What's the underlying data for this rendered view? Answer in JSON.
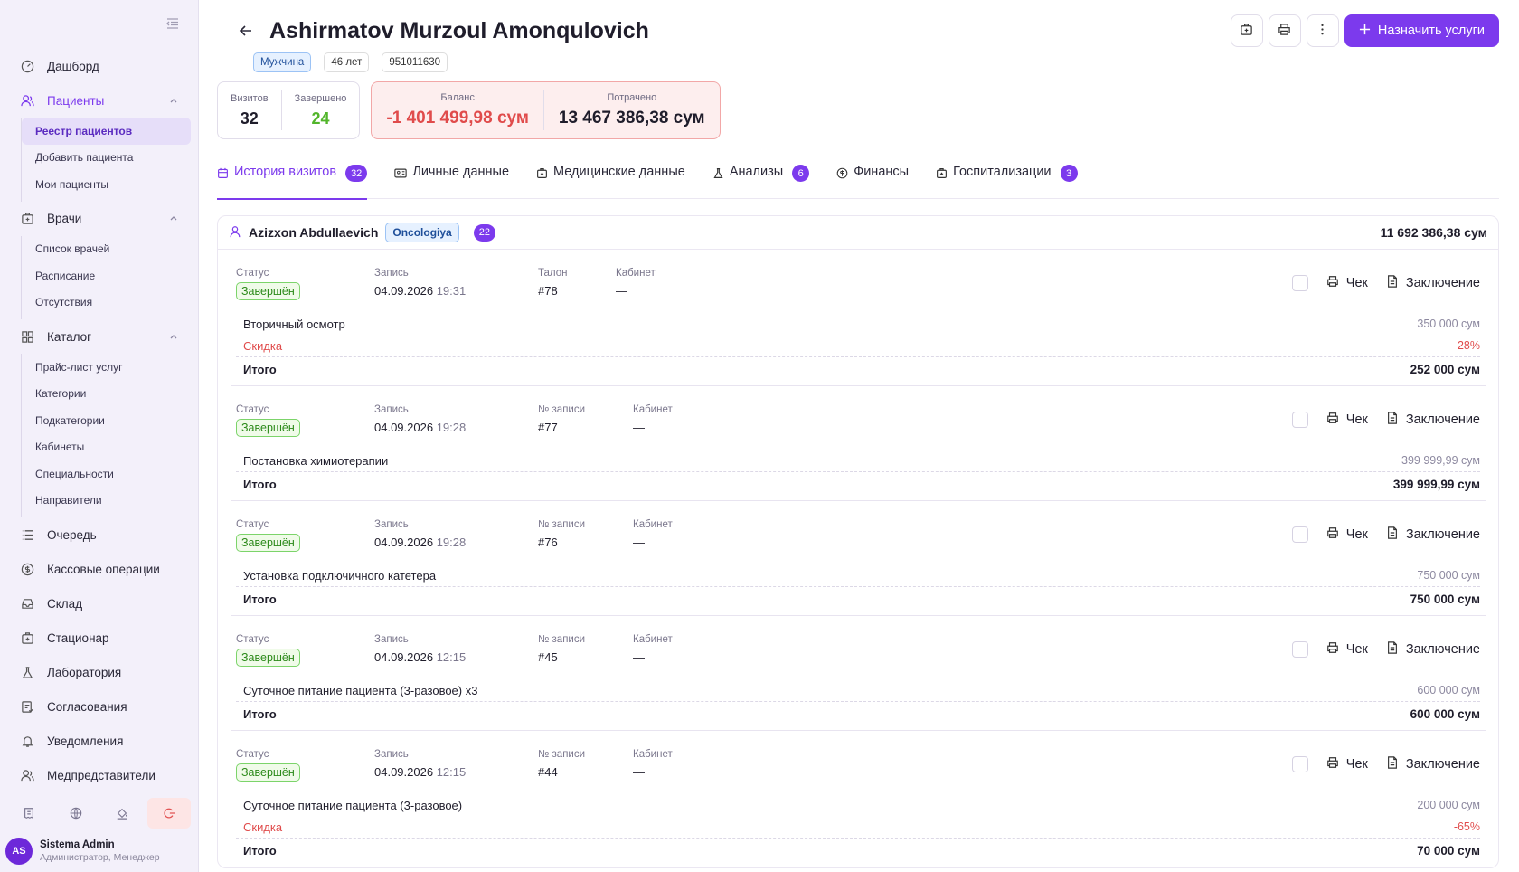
{
  "sidebar": {
    "nav": [
      {
        "label": "Дашборд",
        "icon": "gauge-icon"
      },
      {
        "label": "Пациенты",
        "icon": "users-icon"
      },
      {
        "label": "Врачи",
        "icon": "hospital-bag-icon"
      },
      {
        "label": "Каталог",
        "icon": "grid-icon"
      },
      {
        "label": "Очередь",
        "icon": "list-icon"
      },
      {
        "label": "Кассовые операции",
        "icon": "dollar-icon"
      },
      {
        "label": "Склад",
        "icon": "inbox-icon"
      },
      {
        "label": "Стационар",
        "icon": "hospital-icon"
      },
      {
        "label": "Лаборатория",
        "icon": "flask-icon"
      },
      {
        "label": "Согласования",
        "icon": "approve-icon"
      },
      {
        "label": "Уведомления",
        "icon": "bell-icon"
      },
      {
        "label": "Медпредставители",
        "icon": "users-icon"
      }
    ],
    "patients_sub": [
      "Реестр пациентов",
      "Добавить пациента",
      "Мои пациенты"
    ],
    "doctors_sub": [
      "Список врачей",
      "Расписание",
      "Отсутствия"
    ],
    "catalog_sub": [
      "Прайс-лист услуг",
      "Категории",
      "Подкатегории",
      "Кабинеты",
      "Специальности",
      "Направители"
    ],
    "user": {
      "initials": "AS",
      "name": "Sistema Admin",
      "role": "Администратор, Менеджер"
    }
  },
  "header": {
    "title": "Ashirmatov Murzoul Amonqulovich",
    "assign_label": "Назначить услуги",
    "tags": [
      "Мужчина",
      "46 лет",
      "951011630"
    ]
  },
  "stats": {
    "visits_label": "Визитов",
    "visits": "32",
    "done_label": "Завершено",
    "done": "24",
    "balance_label": "Баланс",
    "balance": "-1 401 499,98 сум",
    "spent_label": "Потрачено",
    "spent": "13 467 386,38 сум"
  },
  "tabs": [
    {
      "label": "История визитов",
      "badge": "32"
    },
    {
      "label": "Личные данные",
      "badge": ""
    },
    {
      "label": "Медицинские данные",
      "badge": ""
    },
    {
      "label": "Анализы",
      "badge": "6"
    },
    {
      "label": "Финансы",
      "badge": ""
    },
    {
      "label": "Госпитализации",
      "badge": "3"
    }
  ],
  "doctor_card": {
    "name": "Azizxon Abdullaevich",
    "specialty": "Oncologiya",
    "count": "22",
    "total": "11 692 386,38 сум"
  },
  "labels": {
    "status": "Статус",
    "record": "Запись",
    "ticket": "Талон",
    "record_no": "№ записи",
    "cabinet": "Кабинет",
    "check": "Чек",
    "conclusion": "Заключение",
    "discount": "Скидка",
    "total": "Итого"
  },
  "visits": [
    {
      "status": "Завершён",
      "date": "04.09.2026",
      "time": "19:31",
      "no_label": "Талон",
      "no": "#78",
      "cabinet": "—",
      "service": "Вторичный осмотр",
      "price": "350 000 сум",
      "discount": "-28%",
      "total": "252 000 сум"
    },
    {
      "status": "Завершён",
      "date": "04.09.2026",
      "time": "19:28",
      "no_label": "№ записи",
      "no": "#77",
      "cabinet": "—",
      "service": "Постановка химиотерапии",
      "price": "399 999,99 сум",
      "discount": "",
      "total": "399 999,99 сум"
    },
    {
      "status": "Завершён",
      "date": "04.09.2026",
      "time": "19:28",
      "no_label": "№ записи",
      "no": "#76",
      "cabinet": "—",
      "service": "Установка подключичного катетера",
      "price": "750 000 сум",
      "discount": "",
      "total": "750 000 сум"
    },
    {
      "status": "Завершён",
      "date": "04.09.2026",
      "time": "12:15",
      "no_label": "№ записи",
      "no": "#45",
      "cabinet": "—",
      "service": "Суточное питание пациента (3-разовое) x3",
      "price": "600 000 сум",
      "discount": "",
      "total": "600 000 сум"
    },
    {
      "status": "Завершён",
      "date": "04.09.2026",
      "time": "12:15",
      "no_label": "№ записи",
      "no": "#44",
      "cabinet": "—",
      "service": "Суточное питание пациента (3-разовое)",
      "price": "200 000 сум",
      "discount": "-65%",
      "total": "70 000 сум"
    }
  ],
  "colors": {
    "accent": "#7c3aed",
    "danger": "#e04b4b",
    "success": "#2c8a1a"
  }
}
